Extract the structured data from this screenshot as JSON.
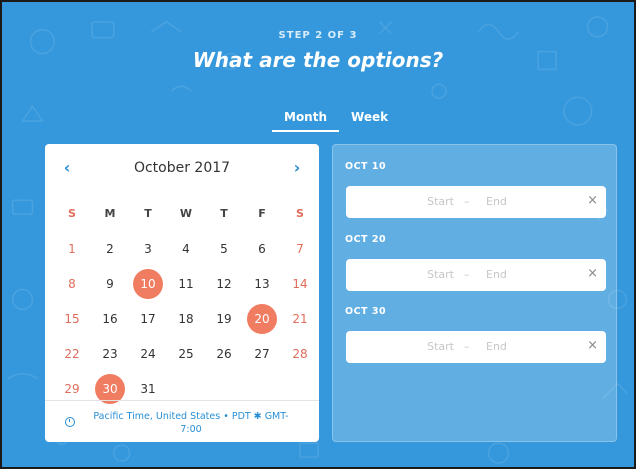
{
  "header": {
    "step": "STEP 2 OF 3",
    "title": "What are the options?"
  },
  "tabs": [
    {
      "label": "Month",
      "active": true
    },
    {
      "label": "Week",
      "active": false
    }
  ],
  "calendar": {
    "month_label": "October 2017",
    "prev_icon": "chevron-left-icon",
    "next_icon": "chevron-right-icon",
    "weekdays": [
      "S",
      "M",
      "T",
      "W",
      "T",
      "F",
      "S"
    ],
    "weeks": [
      [
        "1",
        "2",
        "3",
        "4",
        "5",
        "6",
        "7"
      ],
      [
        "8",
        "9",
        "10",
        "11",
        "12",
        "13",
        "14"
      ],
      [
        "15",
        "16",
        "17",
        "18",
        "19",
        "20",
        "21"
      ],
      [
        "22",
        "23",
        "24",
        "25",
        "26",
        "27",
        "28"
      ],
      [
        "29",
        "30",
        "31",
        "",
        "",
        "",
        ""
      ]
    ],
    "selected_days": [
      "10",
      "20",
      "30"
    ],
    "timezone": "Pacific Time, United States • PDT ✱ GMT-7:00"
  },
  "options": [
    {
      "label": "OCT 10",
      "start_placeholder": "Start",
      "separator": "–",
      "end_placeholder": "End"
    },
    {
      "label": "OCT 20",
      "start_placeholder": "Start",
      "separator": "–",
      "end_placeholder": "End"
    },
    {
      "label": "OCT 30",
      "start_placeholder": "Start",
      "separator": "–",
      "end_placeholder": "End"
    }
  ],
  "colors": {
    "background": "#3598dc",
    "accent": "#2b8fd4",
    "selected": "#f07c61",
    "weekend": "#e06d5b"
  }
}
